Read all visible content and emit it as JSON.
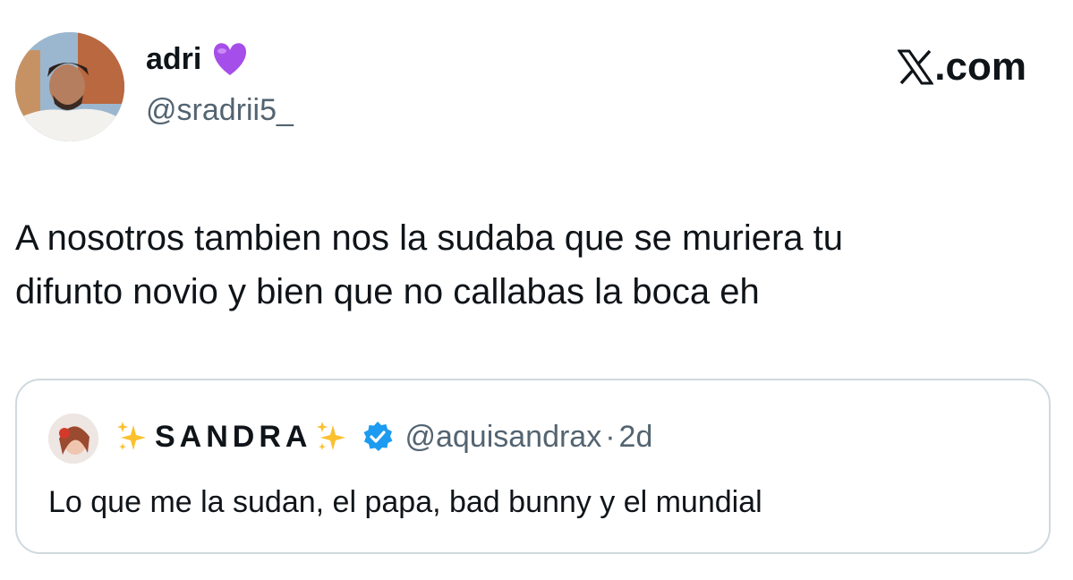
{
  "tweet": {
    "author": {
      "display_name": "adri",
      "handle": "@sradrii5_",
      "badge_emoji_icon": "purple-heart-icon"
    },
    "brand": {
      "logo_icon": "x-logo-icon",
      "label_suffix": ".com"
    },
    "text": "A nosotros tambien nos la sudaba que se muriera tu\ndifunto novio y bien que no callabas la boca eh",
    "quote": {
      "display_name": "SANDRA",
      "name_decoration_icon": "sparkles-icon",
      "verified_icon": "verified-badge-icon",
      "handle": "@aquisandrax",
      "separator": "·",
      "time": "2d",
      "text": "Lo que me la sudan, el papa, bad bunny y el mundial"
    }
  },
  "colors": {
    "text_primary": "#0f1419",
    "text_secondary": "#536471",
    "verified_blue": "#1d9bf0",
    "heart_purple": "#a64ee9",
    "sparkle_yellow": "#fbc02d",
    "card_border": "#cfd9de"
  }
}
